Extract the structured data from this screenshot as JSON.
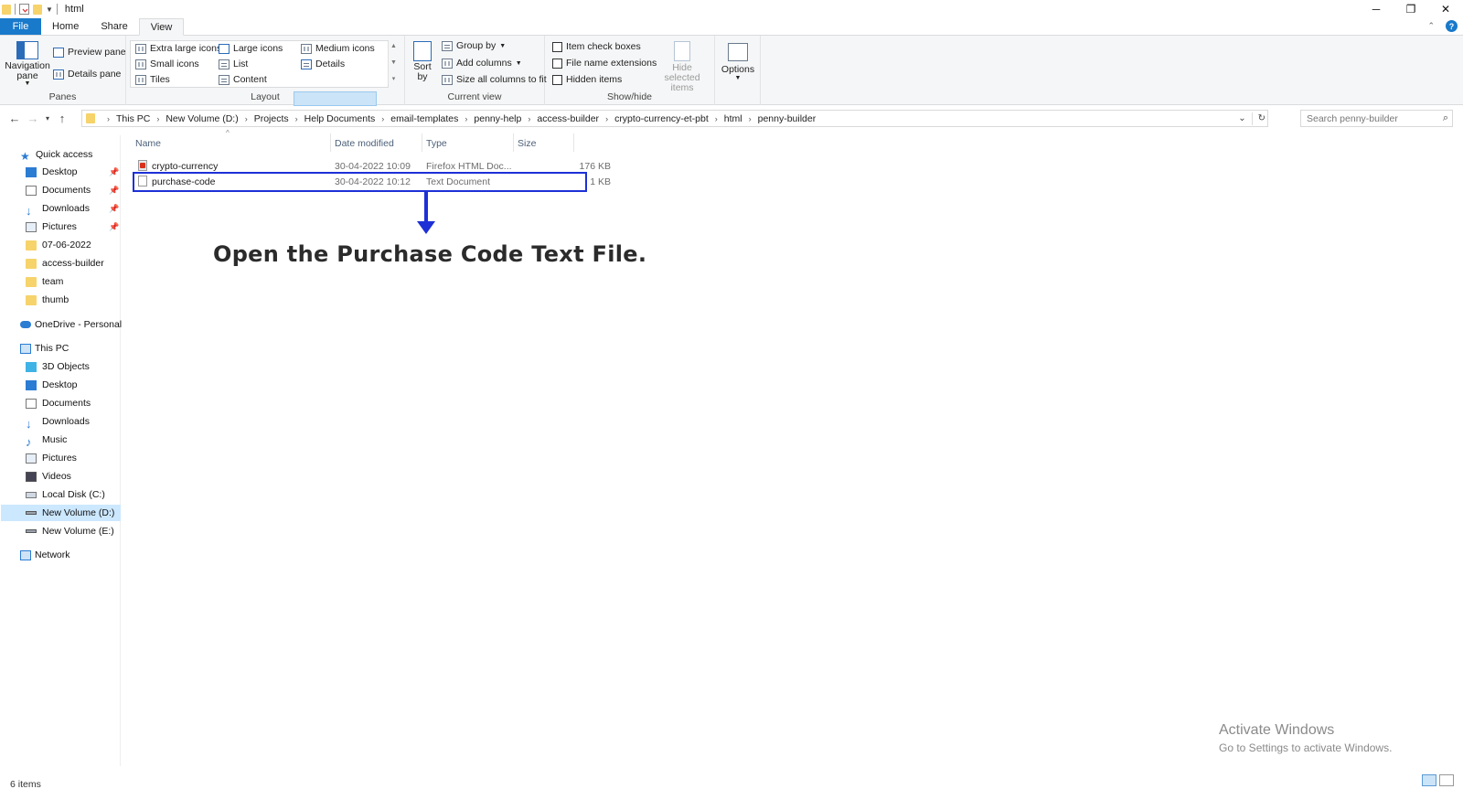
{
  "window": {
    "title": "html",
    "controls": {
      "minimize": "─",
      "maximize": "❐",
      "close": "✕"
    }
  },
  "ribbon": {
    "tabs": [
      "File",
      "Home",
      "Share",
      "View"
    ],
    "active_tab": "View",
    "panes": {
      "label": "Panes",
      "navigation_pane": "Navigation pane",
      "preview_pane": "Preview pane",
      "details_pane": "Details pane"
    },
    "layout": {
      "label": "Layout",
      "options": [
        "Extra large icons",
        "Large icons",
        "Medium icons",
        "Small icons",
        "List",
        "Details",
        "Tiles",
        "Content"
      ],
      "selected": "Details"
    },
    "current_view": {
      "label": "Current view",
      "sort_by": "Sort by",
      "group_by": "Group by",
      "add_columns": "Add columns",
      "size_all_columns": "Size all columns to fit"
    },
    "show_hide": {
      "label": "Show/hide",
      "item_check_boxes": "Item check boxes",
      "file_name_extensions": "File name extensions",
      "hidden_items": "Hidden items",
      "hide_selected_items": "Hide selected items"
    },
    "options": "Options"
  },
  "address_bar": {
    "breadcrumbs": [
      "This PC",
      "New Volume (D:)",
      "Projects",
      "Help Documents",
      "email-templates",
      "penny-help",
      "access-builder",
      "crypto-currency-et-pbt",
      "html",
      "penny-builder"
    ],
    "search_placeholder": "Search penny-builder"
  },
  "sidebar": {
    "quick_access": "Quick access",
    "quick_items": [
      "Desktop",
      "Documents",
      "Downloads",
      "Pictures",
      "07-06-2022",
      "access-builder",
      "team",
      "thumb"
    ],
    "onedrive": "OneDrive - Personal",
    "this_pc": "This PC",
    "pc_items": [
      "3D Objects",
      "Desktop",
      "Documents",
      "Downloads",
      "Music",
      "Pictures",
      "Videos",
      "Local Disk (C:)",
      "New Volume (D:)",
      "New Volume (E:)"
    ],
    "selected": "New Volume (D:)",
    "network": "Network"
  },
  "file_list": {
    "columns": [
      "Name",
      "Date modified",
      "Type",
      "Size"
    ],
    "rows": [
      {
        "name": "crypto-currency",
        "date": "30-04-2022 10:09",
        "type": "Firefox HTML Doc...",
        "size": "176 KB",
        "icon": "firefox-html-file-icon"
      },
      {
        "name": "purchase-code",
        "date": "30-04-2022 10:12",
        "type": "Text Document",
        "size": "1 KB",
        "icon": "text-file-icon"
      }
    ]
  },
  "annotation": {
    "instruction": "Open the Purchase Code Text File.",
    "color": "#1d30d6"
  },
  "watermark": {
    "line1": "Activate Windows",
    "line2": "Go to Settings to activate Windows."
  },
  "status_bar": {
    "item_count": "6 items"
  },
  "colors": {
    "file_tab": "#1979ca",
    "selection": "#cce8ff"
  }
}
